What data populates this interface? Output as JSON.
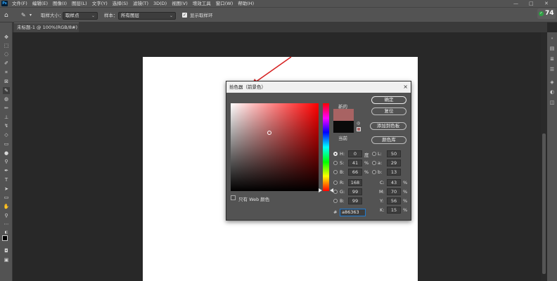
{
  "menubar": {
    "app_icon": "Ps",
    "items": [
      "文件(F)",
      "编辑(E)",
      "图像(I)",
      "图层(L)",
      "文字(Y)",
      "选择(S)",
      "滤镜(T)",
      "3D(D)",
      "视图(V)",
      "增效工具",
      "窗口(W)",
      "帮助(H)"
    ],
    "window_controls": [
      "—",
      "□",
      "✕"
    ]
  },
  "options": {
    "home_icon": "home-icon",
    "tool_icon": "eyedropper-icon",
    "sample_size_label": "取样大小：",
    "sample_size_value": "取样点",
    "sample_label": "样本：",
    "sample_value": "所有图层",
    "show_ring_label": "显示取样环",
    "badge_value": "74"
  },
  "tab": {
    "title": "未标题-1 @ 100%(RGB/8#)",
    "close": "×"
  },
  "dialog": {
    "title": "拾色器（前景色）",
    "close": "×",
    "new_label": "新的",
    "current_label": "当前",
    "new_color": "#a86363",
    "current_color": "#0a0a0a",
    "buttons": {
      "ok": "确定",
      "reset": "复位",
      "add_swatch": "添加到色板",
      "color_libraries": "颜色库"
    },
    "hsb": {
      "h_label": "H:",
      "h_value": "0",
      "h_unit": "度",
      "s_label": "S:",
      "s_value": "41",
      "s_unit": "%",
      "b_label": "B:",
      "b_value": "66",
      "b_unit": "%"
    },
    "rgb": {
      "r_label": "R:",
      "r_value": "168",
      "g_label": "G:",
      "g_value": "99",
      "b_label": "B:",
      "b_value": "99"
    },
    "lab": {
      "l_label": "L:",
      "l_value": "50",
      "a_label": "a:",
      "a_value": "29",
      "b_label": "b:",
      "b_value": "13"
    },
    "cmyk": {
      "c_label": "C:",
      "c_value": "43",
      "c_unit": "%",
      "m_label": "M:",
      "m_value": "70",
      "m_unit": "%",
      "y_label": "Y:",
      "y_value": "56",
      "y_unit": "%",
      "k_label": "K:",
      "k_value": "15",
      "k_unit": "%"
    },
    "hex_label": "#",
    "hex_value": "a86363",
    "web_only_label": "只有 Web 颜色"
  },
  "colors": {
    "annotation_arrow": "#d62020",
    "canvas": "#ffffff"
  }
}
